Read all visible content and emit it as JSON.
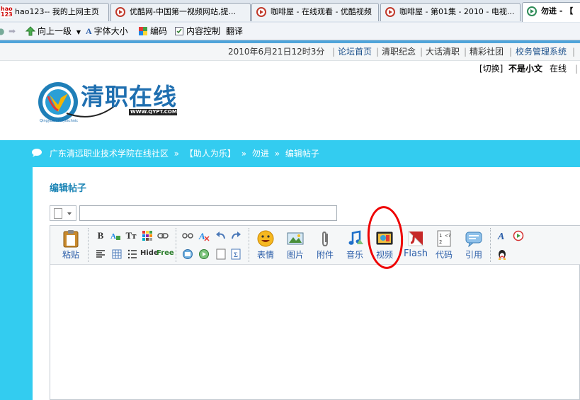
{
  "browser": {
    "tabs": [
      {
        "label": "hao123-- 我的上网主页",
        "active": false
      },
      {
        "label": "优酷网-中国第一视频网站,提...",
        "active": false
      },
      {
        "label": "咖啡屋 - 在线观看 - 优酷视频",
        "active": false
      },
      {
        "label": "咖啡屋 - 第01集 - 2010 - 电视...",
        "active": false
      },
      {
        "label": "勿进 - 【",
        "active": true
      }
    ],
    "toolbar": {
      "up_label": "向上一级",
      "font_label": "字体大小",
      "encoding_label": "编码",
      "content_label": "内容控制",
      "translate_label": "翻译"
    }
  },
  "forum": {
    "datetime": "2010年6月21日12时3分",
    "links": [
      "论坛首页",
      "清职纪念",
      "大话清职",
      "精彩社团",
      "校务管理系统"
    ],
    "userbar": {
      "switch": "[切换]",
      "username": "不是小文",
      "status": "在线"
    },
    "logo": {
      "title": "清职在线",
      "url": "WWW.QYPT.COM",
      "sub": "Qingyuan Polytechnic"
    },
    "breadcrumb": [
      "广东清远职业技术学院在线社区",
      "»",
      "【助人为乐】",
      "»",
      "勿进",
      "»",
      "编辑帖子"
    ],
    "page_title": "编辑帖子",
    "editor": {
      "paste_label": "粘贴",
      "emoticon_label": "表情",
      "image_label": "图片",
      "attachment_label": "附件",
      "music_label": "音乐",
      "video_label": "视频",
      "flash_label": "Flash",
      "code_label": "代码",
      "quote_label": "引用",
      "hide_label": "Hide",
      "free_label": "Free"
    }
  },
  "colors": {
    "band": "#33ccf0",
    "annotation": "#e00000",
    "title": "#1b84b5"
  }
}
